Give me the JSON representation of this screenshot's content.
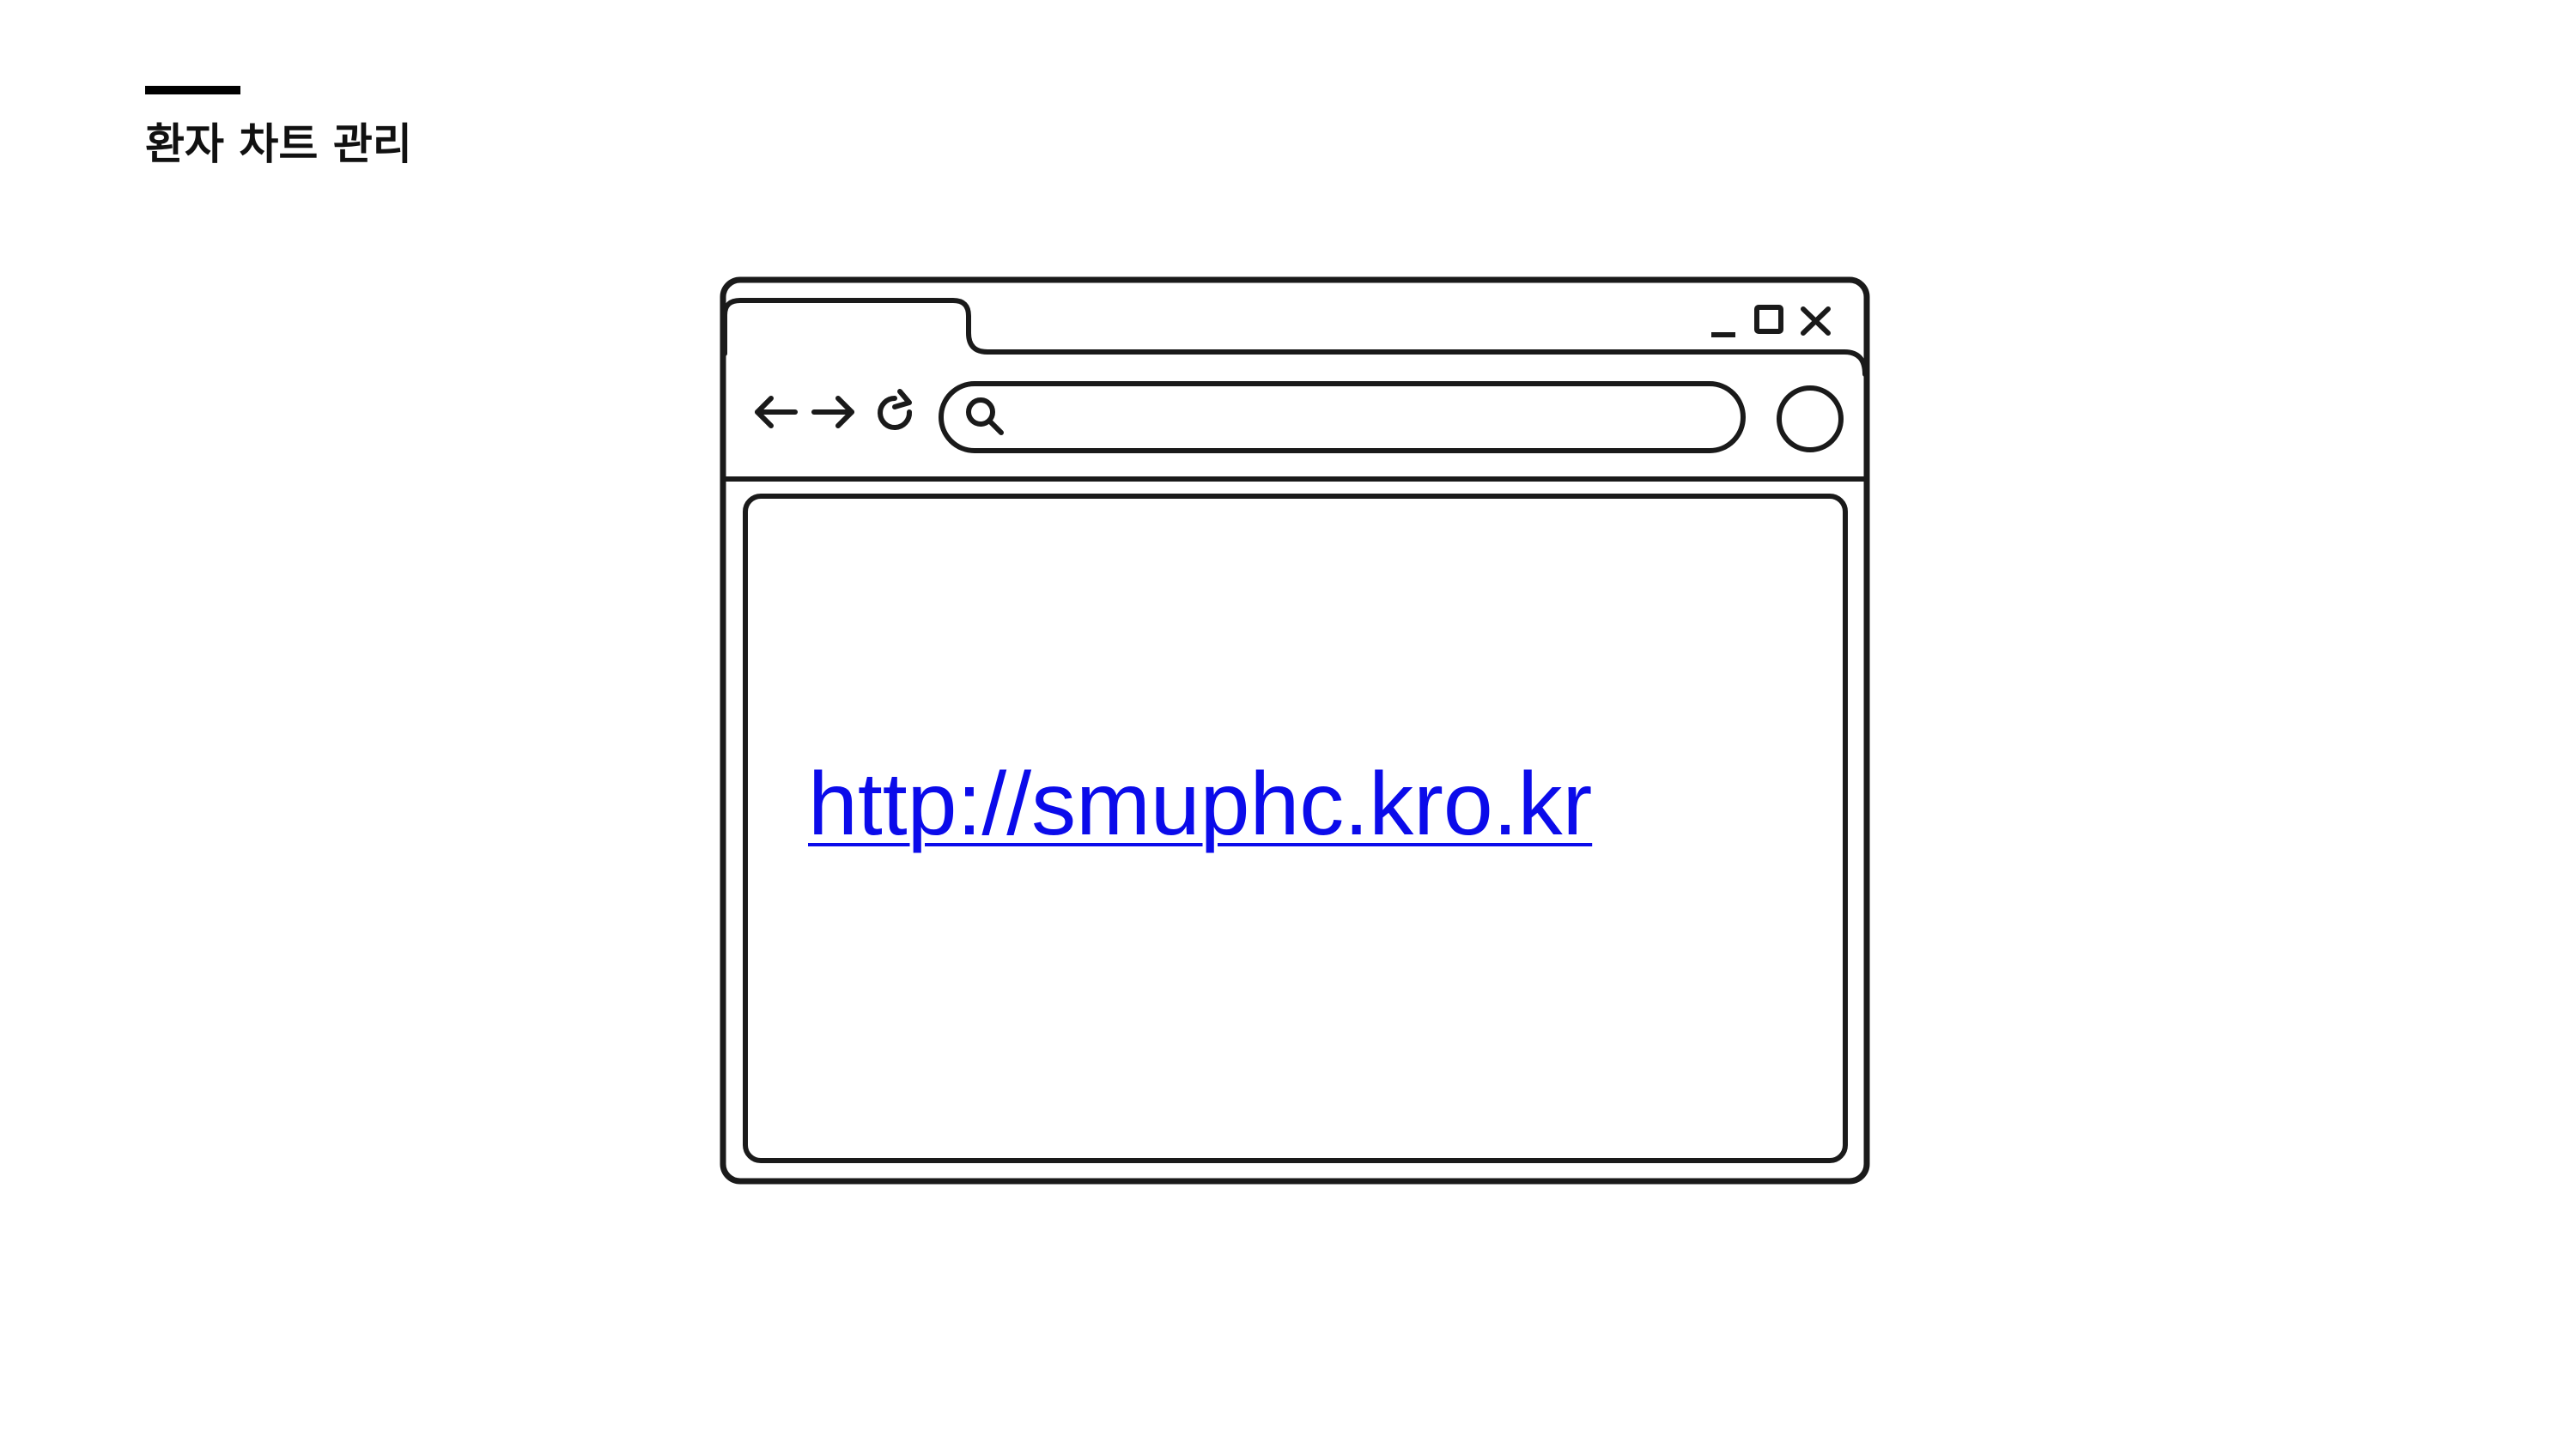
{
  "slide": {
    "title": "환자 차트 관리"
  },
  "browser": {
    "content_link": "http://smuphc.kro.kr",
    "icons": {
      "back": "arrow-left-icon",
      "forward": "arrow-right-icon",
      "reload": "reload-icon",
      "search": "search-icon",
      "minimize": "minimize-icon",
      "maximize": "maximize-icon",
      "close": "close-icon",
      "profile": "circle-icon"
    }
  },
  "colors": {
    "link": "#0b0bea",
    "outline": "#1a1a1a",
    "title": "#111111",
    "accent_bar": "#000000"
  }
}
